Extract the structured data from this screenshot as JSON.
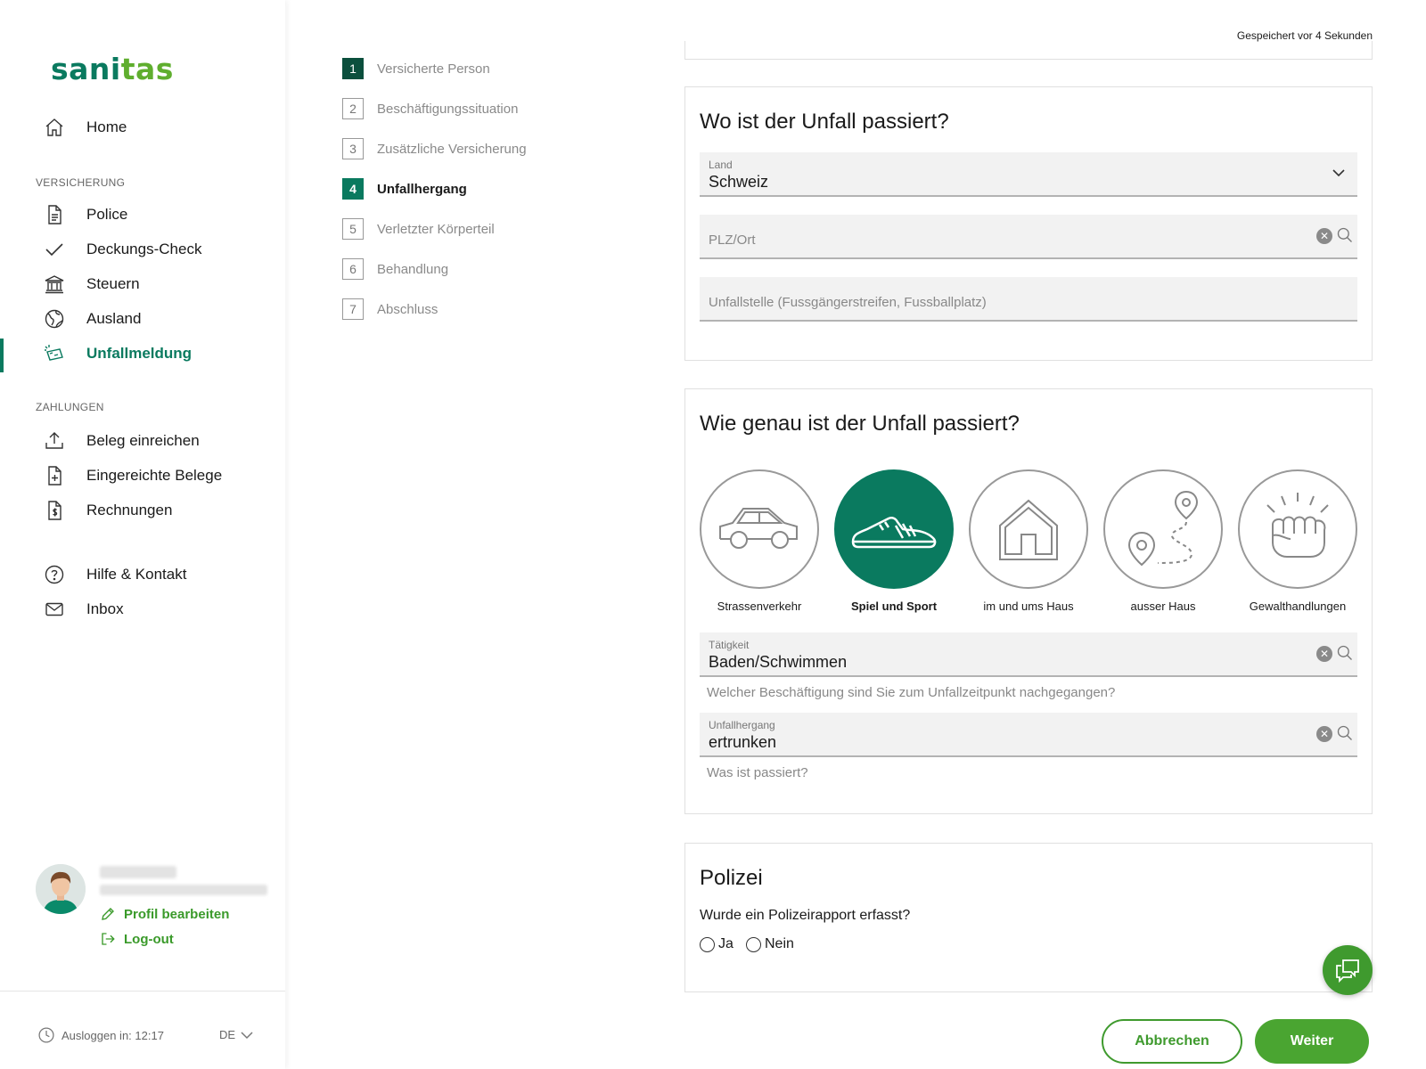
{
  "app": {
    "logo_prefix": "sani",
    "logo_accent": "tas"
  },
  "colors": {
    "brand_green": "#0a7a5f",
    "accent_green": "#4aa531",
    "selected_step": "#0a7a5f"
  },
  "sidebar": {
    "home": {
      "label": "Home",
      "icon": "home-icon"
    },
    "section_insurance": "VERSICHERUNG",
    "insurance_items": [
      {
        "label": "Police",
        "icon": "document-icon"
      },
      {
        "label": "Deckungs-Check",
        "icon": "check-icon"
      },
      {
        "label": "Steuern",
        "icon": "bank-icon"
      },
      {
        "label": "Ausland",
        "icon": "globe-icon"
      },
      {
        "label": "Unfallmeldung",
        "icon": "accident-icon",
        "active": true
      }
    ],
    "section_payments": "ZAHLUNGEN",
    "payment_items": [
      {
        "label": "Beleg einreichen",
        "icon": "upload-icon"
      },
      {
        "label": "Eingereichte Belege",
        "icon": "document-plus-icon"
      },
      {
        "label": "Rechnungen",
        "icon": "invoice-icon"
      }
    ],
    "help": {
      "label": "Hilfe & Kontakt",
      "icon": "help-icon"
    },
    "inbox": {
      "label": "Inbox",
      "icon": "mail-icon"
    },
    "profile": {
      "edit_label": "Profil bearbeiten",
      "logout_label": "Log-out"
    },
    "footer": {
      "logout_timer": "Ausloggen in: 12:17",
      "language": "DE"
    }
  },
  "steps": [
    {
      "num": "1",
      "label": "Versicherte Person",
      "state": "done"
    },
    {
      "num": "2",
      "label": "Beschäftigungssituation",
      "state": "todo"
    },
    {
      "num": "3",
      "label": "Zusätzliche Versicherung",
      "state": "todo"
    },
    {
      "num": "4",
      "label": "Unfallhergang",
      "state": "current"
    },
    {
      "num": "5",
      "label": "Verletzter Körperteil",
      "state": "todo"
    },
    {
      "num": "6",
      "label": "Behandlung",
      "state": "todo"
    },
    {
      "num": "7",
      "label": "Abschluss",
      "state": "todo"
    }
  ],
  "saved_status": "Gespeichert vor 4 Sekunden",
  "where": {
    "title": "Wo ist der Unfall passiert?",
    "country": {
      "label": "Land",
      "value": "Schweiz"
    },
    "zip_placeholder": "PLZ/Ort",
    "location_placeholder": "Unfallstelle (Fussgängerstreifen, Fussballplatz)"
  },
  "how": {
    "title": "Wie genau ist der Unfall passiert?",
    "categories": [
      {
        "label": "Strassenverkehr",
        "icon": "car-icon",
        "selected": false
      },
      {
        "label": "Spiel und Sport",
        "icon": "sneaker-icon",
        "selected": true
      },
      {
        "label": "im und ums Haus",
        "icon": "house-icon",
        "selected": false
      },
      {
        "label": "ausser Haus",
        "icon": "route-pin-icon",
        "selected": false
      },
      {
        "label": "Gewalthandlungen",
        "icon": "fist-icon",
        "selected": false
      }
    ],
    "activity": {
      "label": "Tätigkeit",
      "value": "Baden/Schwimmen",
      "hint": "Welcher Beschäftigung sind Sie zum Unfallzeitpunkt nachgegangen?"
    },
    "course": {
      "label": "Unfallhergang",
      "value": "ertrunken",
      "hint": "Was ist passiert?"
    }
  },
  "police": {
    "title": "Polizei",
    "question": "Wurde ein Polizeirapport erfasst?",
    "options": [
      "Ja",
      "Nein"
    ]
  },
  "actions": {
    "cancel": "Abbrechen",
    "next": "Weiter"
  }
}
